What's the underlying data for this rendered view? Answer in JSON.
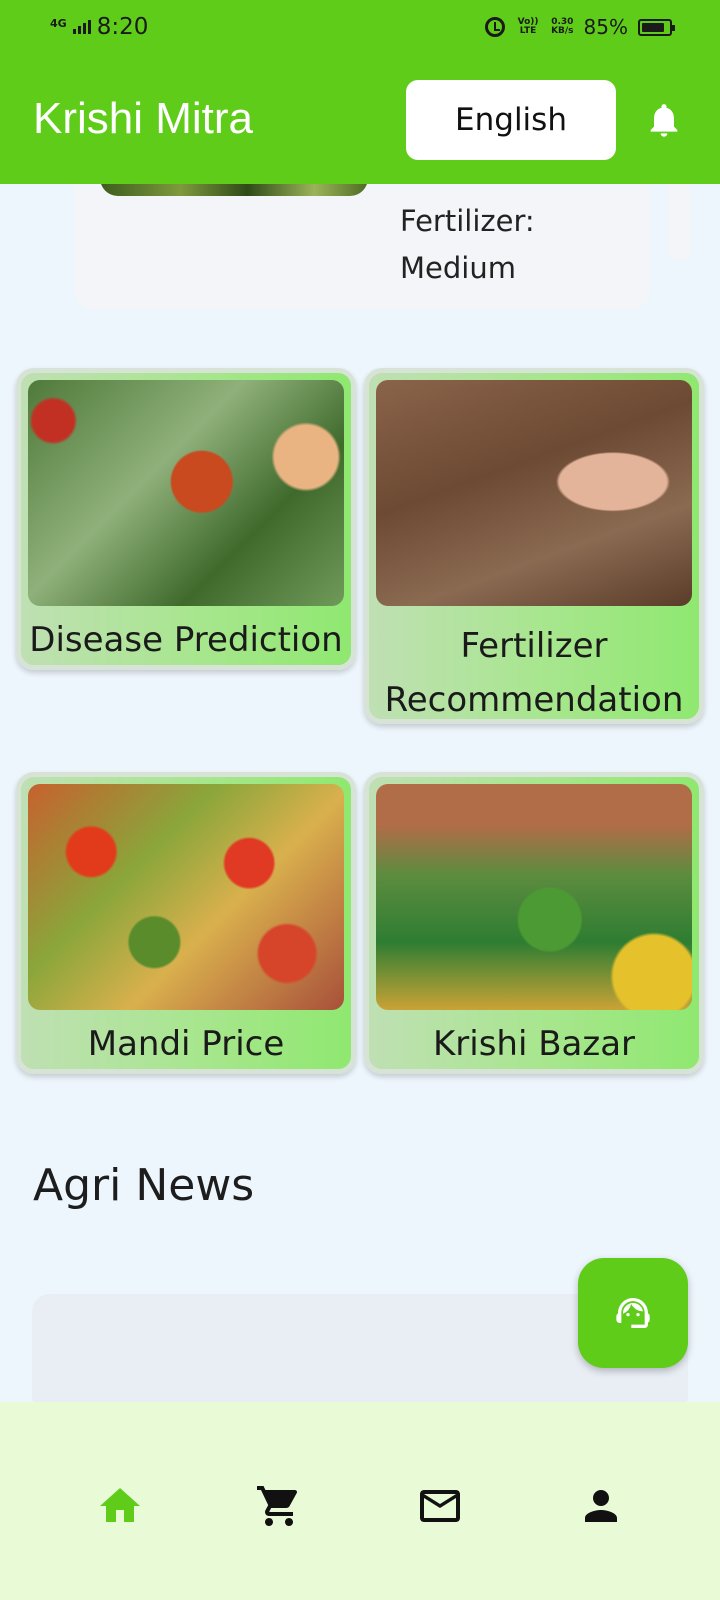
{
  "status_bar": {
    "network": "4G",
    "time": "8:20",
    "volte": "Vo)) LTE",
    "speed_value": "0.30",
    "speed_unit": "KB/s",
    "battery": "85%",
    "battery_level": 0.85
  },
  "app_bar": {
    "title": "Krishi Mitra",
    "language_label": "English",
    "bell_icon": "notifications-bell-icon"
  },
  "crop_card": {
    "fertilizer_label": "Fertilizer:",
    "fertilizer_value": "Medium"
  },
  "features": [
    {
      "label": "Disease Prediction",
      "image": "diseased-tomato-plant"
    },
    {
      "label_line1": "Fertilizer",
      "label_line2": "Recommendation",
      "image": "soil-in-hand"
    },
    {
      "label": "Mandi Price",
      "image": "vegetable-market-stalls"
    },
    {
      "label": "Krishi Bazar",
      "image": "produce-wholesale-market"
    }
  ],
  "news": {
    "title": "Agri News"
  },
  "fab": {
    "icon": "support-agent-icon"
  },
  "bottom_nav": [
    {
      "icon": "home-icon",
      "active": true
    },
    {
      "icon": "cart-icon",
      "active": false
    },
    {
      "icon": "mail-icon",
      "active": false
    },
    {
      "icon": "profile-icon",
      "active": false
    }
  ],
  "colors": {
    "brand_green": "#5fcc1a",
    "background": "#eef6fd",
    "nav_background": "#e8fbd6"
  }
}
